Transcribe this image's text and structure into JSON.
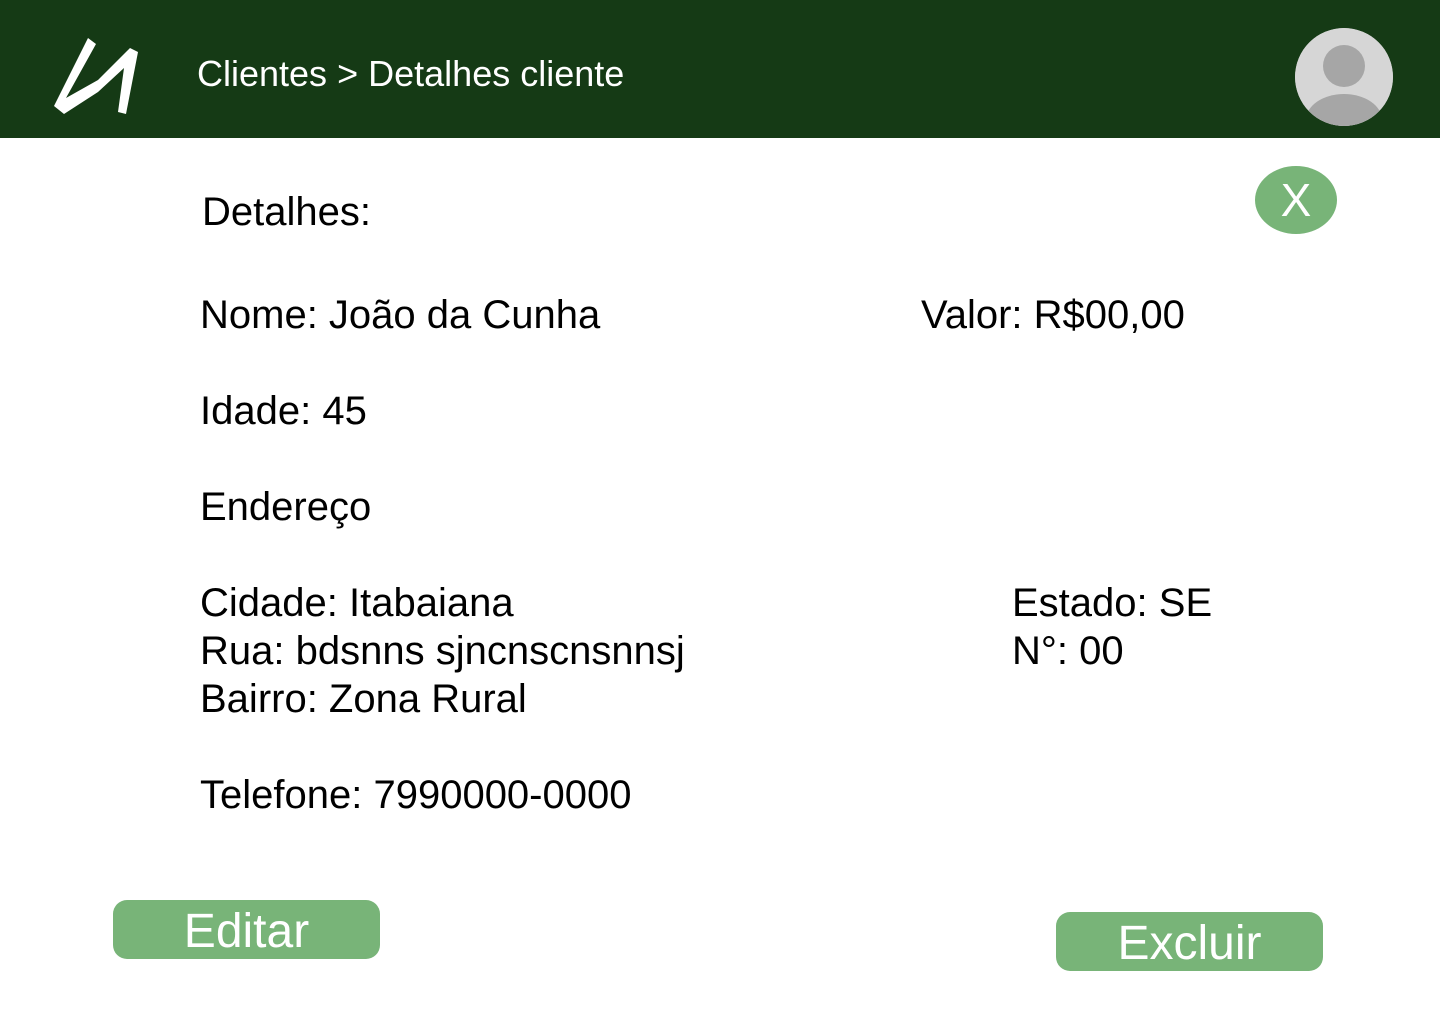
{
  "header": {
    "breadcrumb": {
      "parent": "Clientes",
      "separator": ">",
      "current": "Detalhes cliente"
    },
    "logo_icon": "logo-icon",
    "avatar_icon": "user-avatar-icon",
    "background_color": "#153a15"
  },
  "panel": {
    "title": "Detalhes:",
    "close_label": "X",
    "fields": {
      "nome": "Nome: João da Cunha",
      "valor": "Valor: R$00,00",
      "idade": "Idade: 45",
      "endereco_heading": "Endereço",
      "cidade": "Cidade: Itabaiana",
      "estado": "Estado: SE",
      "rua": "Rua: bdsnns sjncnscnsnnsj",
      "numero": "N°: 00",
      "bairro": "Bairro: Zona Rural",
      "telefone": "Telefone: 7990000-0000"
    }
  },
  "actions": {
    "edit_label": "Editar",
    "delete_label": "Excluir"
  },
  "colors": {
    "accent": "#78b478",
    "header": "#153a15"
  }
}
